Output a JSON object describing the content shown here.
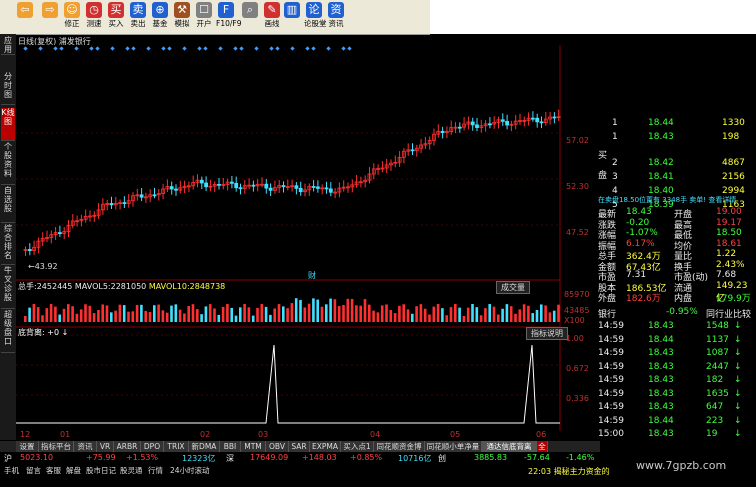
{
  "toolbar": {
    "items": [
      {
        "label": "",
        "icon": "back-icon",
        "color": "#f0a030"
      },
      {
        "label": "",
        "icon": "forward-icon",
        "color": "#f0a030"
      },
      {
        "label": "修正",
        "icon": "repair-icon",
        "color": "#f0a030"
      },
      {
        "label": "测速",
        "icon": "speedtest-icon",
        "color": "#d03030"
      },
      {
        "label": "买入",
        "icon": "buy-icon",
        "color": "#d03030"
      },
      {
        "label": "卖出",
        "icon": "sell-icon",
        "color": "#2060d0"
      },
      {
        "label": "基金",
        "icon": "fund-icon",
        "color": "#2060d0"
      },
      {
        "label": "模拟",
        "icon": "simulate-icon",
        "color": "#a05020"
      },
      {
        "label": "开户",
        "icon": "open-account-icon",
        "color": "#808080"
      },
      {
        "label": "F10/F9",
        "icon": "f10-icon",
        "color": "#2060d0"
      },
      {
        "label": "",
        "icon": "zoom-icon",
        "color": "#808080"
      },
      {
        "label": "画线",
        "icon": "draw-line-icon",
        "color": "#d03030"
      },
      {
        "label": "",
        "icon": "chart-icon",
        "color": "#2060d0"
      },
      {
        "label": "论股堂",
        "icon": "forum-icon",
        "color": "#2060d0"
      },
      {
        "label": "资讯",
        "icon": "news-icon",
        "color": "#2060d0"
      }
    ]
  },
  "left_tabs": [
    "应用",
    "分时图",
    "K线图",
    "个股资料",
    "自选股",
    "综合排名",
    "牛叉诊股",
    "超级盘口"
  ],
  "chart_title": "日线(复权) 浦发银行",
  "price_labels": [
    "57.02",
    "52.30",
    "47.52"
  ],
  "low_marker": "43.92",
  "cai_label": "财",
  "volume": {
    "head_total_label": "总手:",
    "head_total": "2452445",
    "mavol5_label": "MAVOL5:",
    "mavol5": "2281050",
    "mavol10_label": "MAVOL10:",
    "mavol10": "2848738",
    "button": "成交量",
    "axis": [
      "85970",
      "43485",
      "X100"
    ]
  },
  "indicator": {
    "head": "底背离: +0 ↓",
    "button": "指标说明",
    "axis": [
      "1.00",
      "0.672",
      "0.336"
    ]
  },
  "x_axis": [
    "12",
    "01",
    "02",
    "03",
    "04",
    "05",
    "06"
  ],
  "bottom_tabs": [
    "设置",
    "指标平台",
    "资讯",
    "VR",
    "ARBR",
    "DPO",
    "TRIX",
    "新DMA",
    "BBI",
    "MTM",
    "OBV",
    "SAR",
    "EXPMA",
    "买入点1",
    "同花顺资金博弈",
    "同花顺小单净量",
    "通达信底背离",
    "全"
  ],
  "status": {
    "sh_label": "沪",
    "sh_index": "5023.10",
    "sh_change": "+75.99",
    "sh_pct": "+1.53%",
    "sh_amount": "12323亿",
    "sz_label": "深",
    "sz_index": "17649.09",
    "sz_change": "+148.03",
    "sz_pct": "+0.85%",
    "sz_amount": "10716亿",
    "cy_label": "创",
    "cy_index": "3885.83",
    "cy_change": "-57.64",
    "cy_pct": "-1.46%"
  },
  "status2": [
    "手机",
    "留言",
    "客服",
    "解盘",
    "股市日记",
    "股灵通",
    "行情",
    "24小时滚动"
  ],
  "status2_right": "22:03 揭秘主力资金的",
  "right_panel": {
    "sell_rows": [
      {
        "level": "1",
        "price": "18.44",
        "vol": "1330"
      },
      {
        "level": "1",
        "price": "18.43",
        "vol": "198"
      }
    ],
    "buy_label": "买盘",
    "buy_rows": [
      {
        "level": "2",
        "price": "18.42",
        "vol": "4867"
      },
      {
        "level": "3",
        "price": "18.41",
        "vol": "2156"
      },
      {
        "level": "4",
        "price": "18.40",
        "vol": "2994"
      },
      {
        "level": "5",
        "price": "18.39",
        "vol": "1163"
      }
    ],
    "info_line": "在卖盘18.50位置有 3348手 卖单! 查看详情",
    "stats": [
      [
        "最新",
        "18.43",
        "开盘",
        "19.00"
      ],
      [
        "涨跌",
        "-0.20",
        "最高",
        "19.17"
      ],
      [
        "涨幅",
        "-1.07%",
        "最低",
        "18.50"
      ],
      [
        "振幅",
        "6.17%",
        "均价",
        "18.61"
      ],
      [
        "总手",
        "362.4万",
        "量比",
        "1.22"
      ],
      [
        "金额",
        "67.43亿",
        "换手",
        "2.43%"
      ],
      [
        "市盈",
        "7.31",
        "市盈(动)",
        "7.68"
      ],
      [
        "股本",
        "186.53亿",
        "流通",
        "149.23亿"
      ],
      [
        "外盘",
        "182.6万",
        "内盘",
        "179.9万"
      ]
    ],
    "industry_label": "银行",
    "industry_pct": "-0.95%",
    "industry_link": "同行业比较",
    "ticks": [
      {
        "time": "14:59",
        "price": "18.43",
        "vol": "1548",
        "dir": "down"
      },
      {
        "time": "14:59",
        "price": "18.44",
        "vol": "1137",
        "dir": "down"
      },
      {
        "time": "14:59",
        "price": "18.43",
        "vol": "1087",
        "dir": "down"
      },
      {
        "time": "14:59",
        "price": "18.43",
        "vol": "2447",
        "dir": "down"
      },
      {
        "time": "14:59",
        "price": "18.43",
        "vol": "182",
        "dir": "down"
      },
      {
        "time": "14:59",
        "price": "18.43",
        "vol": "1635",
        "dir": "down"
      },
      {
        "time": "14:59",
        "price": "18.43",
        "vol": "647",
        "dir": "down"
      },
      {
        "time": "14:59",
        "price": "18.44",
        "vol": "223",
        "dir": "down"
      },
      {
        "time": "15:00",
        "price": "18.43",
        "vol": "19",
        "dir": "down"
      }
    ]
  },
  "watermark": "www.7gpzb.com"
}
